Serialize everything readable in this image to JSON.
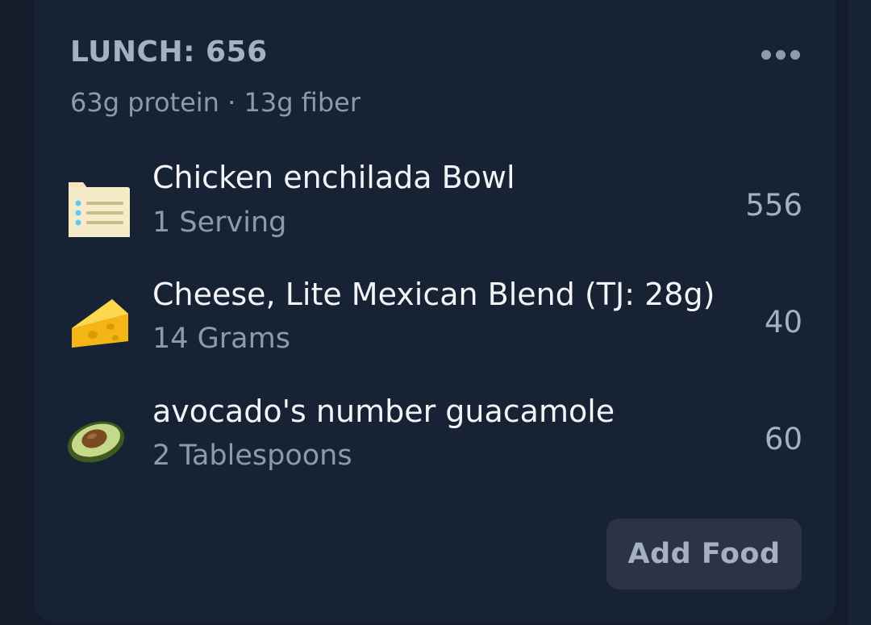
{
  "meal": {
    "title": "LUNCH: 656",
    "subtitle": "63g protein · 13g fiber",
    "menu_icon": "more-horizontal-icon"
  },
  "foods": [
    {
      "name": "Chicken enchilada Bowl",
      "quantity": "1 Serving",
      "calories": "556",
      "icon": "recipe-card-icon"
    },
    {
      "name": "Cheese, Lite Mexican Blend (TJ: 28g)",
      "quantity": "14 Grams",
      "calories": "40",
      "icon": "cheese-icon"
    },
    {
      "name": "avocado's number guacamole",
      "quantity": "2 Tablespoons",
      "calories": "60",
      "icon": "avocado-icon"
    }
  ],
  "actions": {
    "add_food_label": "Add Food"
  },
  "colors": {
    "background": "#131c2b",
    "card": "#172234",
    "primary_text": "#f2f4f7",
    "secondary_text": "#8e9aac",
    "button_bg": "#2b3446"
  }
}
